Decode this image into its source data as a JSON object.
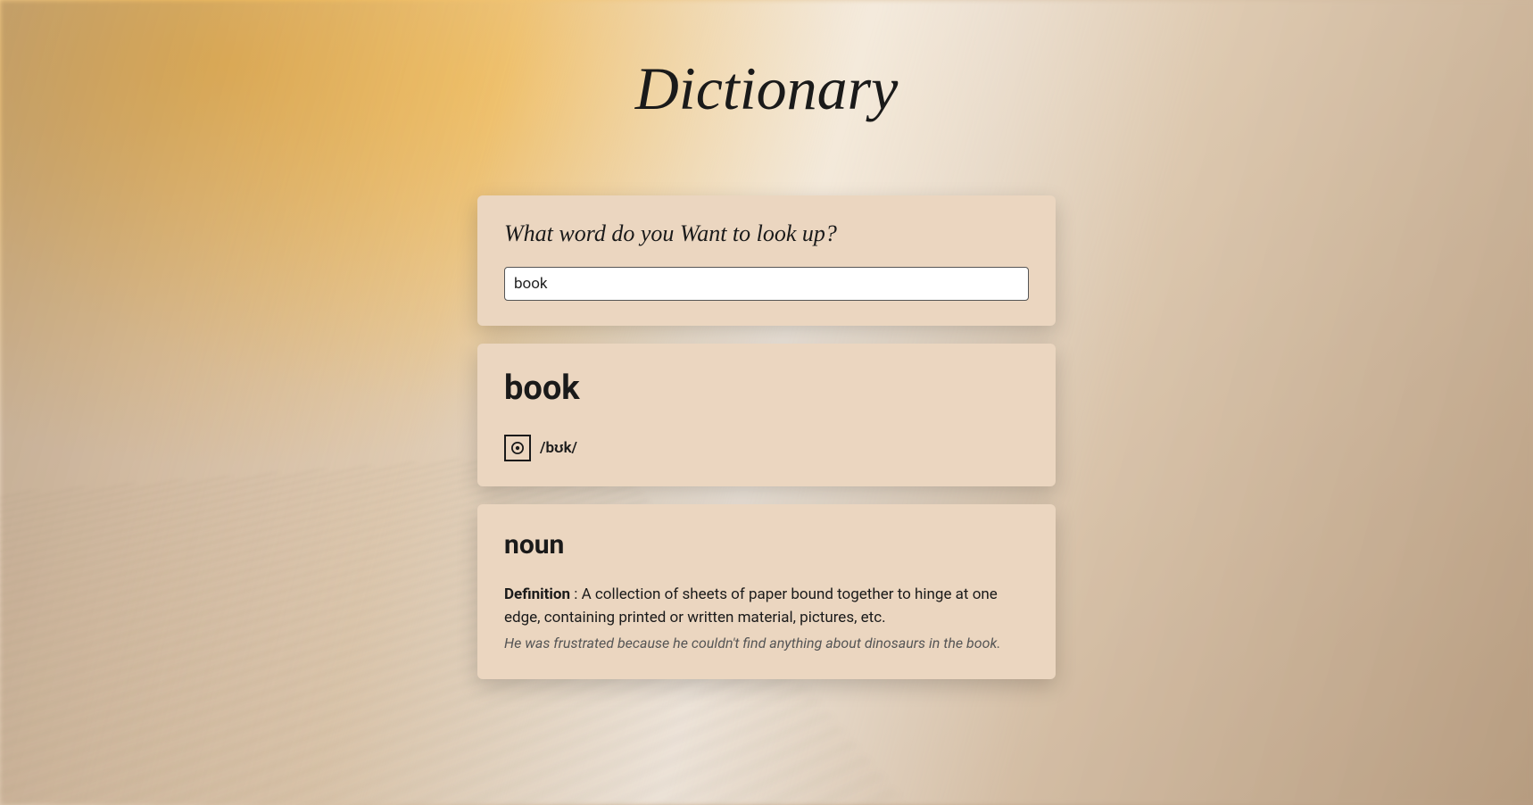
{
  "header": {
    "title": "Dictionary"
  },
  "search": {
    "label": "What word do you Want to look up?",
    "value": "book"
  },
  "result": {
    "word": "book",
    "phonetic": "/bʊk/"
  },
  "meaning": {
    "part_of_speech": "noun",
    "definition_label": "Definition",
    "definition_text": " : A collection of sheets of paper bound together to hinge at one edge, containing printed or written material, pictures, etc.",
    "example": "He was frustrated because he couldn't find anything about dinosaurs in the book."
  }
}
